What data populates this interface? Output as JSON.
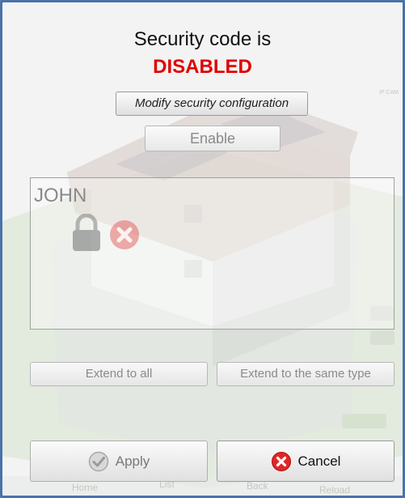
{
  "dialog": {
    "title": "Security code is",
    "status": "DISABLED",
    "status_color": "#e00000",
    "modify_label": "Modify security configuration",
    "enable_label": "Enable",
    "user_name": "JOHN",
    "extend_all_label": "Extend to all",
    "extend_type_label": "Extend to the same type",
    "apply_label": "Apply",
    "cancel_label": "Cancel"
  },
  "background": {
    "nav": [
      "Home",
      "List",
      "Back",
      "Reload"
    ],
    "ipcam_label": "IP CAM"
  },
  "icons": {
    "lock": "lock-icon",
    "disabled": "x-circle-icon",
    "apply": "check-circle-icon",
    "cancel": "x-circle-icon"
  }
}
